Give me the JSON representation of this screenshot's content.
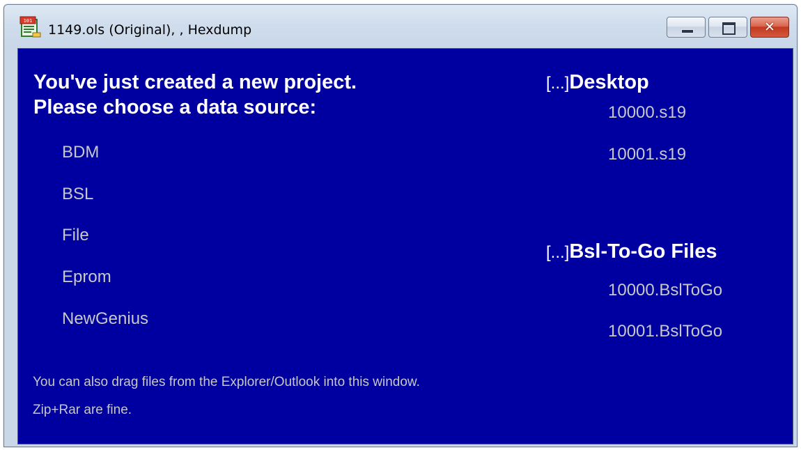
{
  "window": {
    "title": "1149.ols (Original), , Hexdump",
    "app_icon": "document-hex-icon",
    "controls": {
      "minimize_icon": "minimize-icon",
      "maximize_icon": "maximize-icon",
      "close_glyph": "✕"
    }
  },
  "content": {
    "background_color": "#0000a0",
    "heading_line1": "You've just created a new project.",
    "heading_line2": "Please choose a data source:",
    "sources": [
      {
        "label": "BDM"
      },
      {
        "label": "BSL"
      },
      {
        "label": "File"
      },
      {
        "label": "Eprom"
      },
      {
        "label": "NewGenius"
      }
    ],
    "hint_line1": "You can also drag files from the Explorer/Outlook into this window.",
    "hint_line2": "Zip+Rar are fine."
  },
  "desktop": {
    "bracket": "[...]",
    "title": "Desktop",
    "files": [
      "10000.s19",
      "10001.s19"
    ]
  },
  "bsl": {
    "bracket": "[...]",
    "title": "Bsl-To-Go Files",
    "files": [
      "10000.BslToGo",
      "10001.BslToGo"
    ]
  }
}
